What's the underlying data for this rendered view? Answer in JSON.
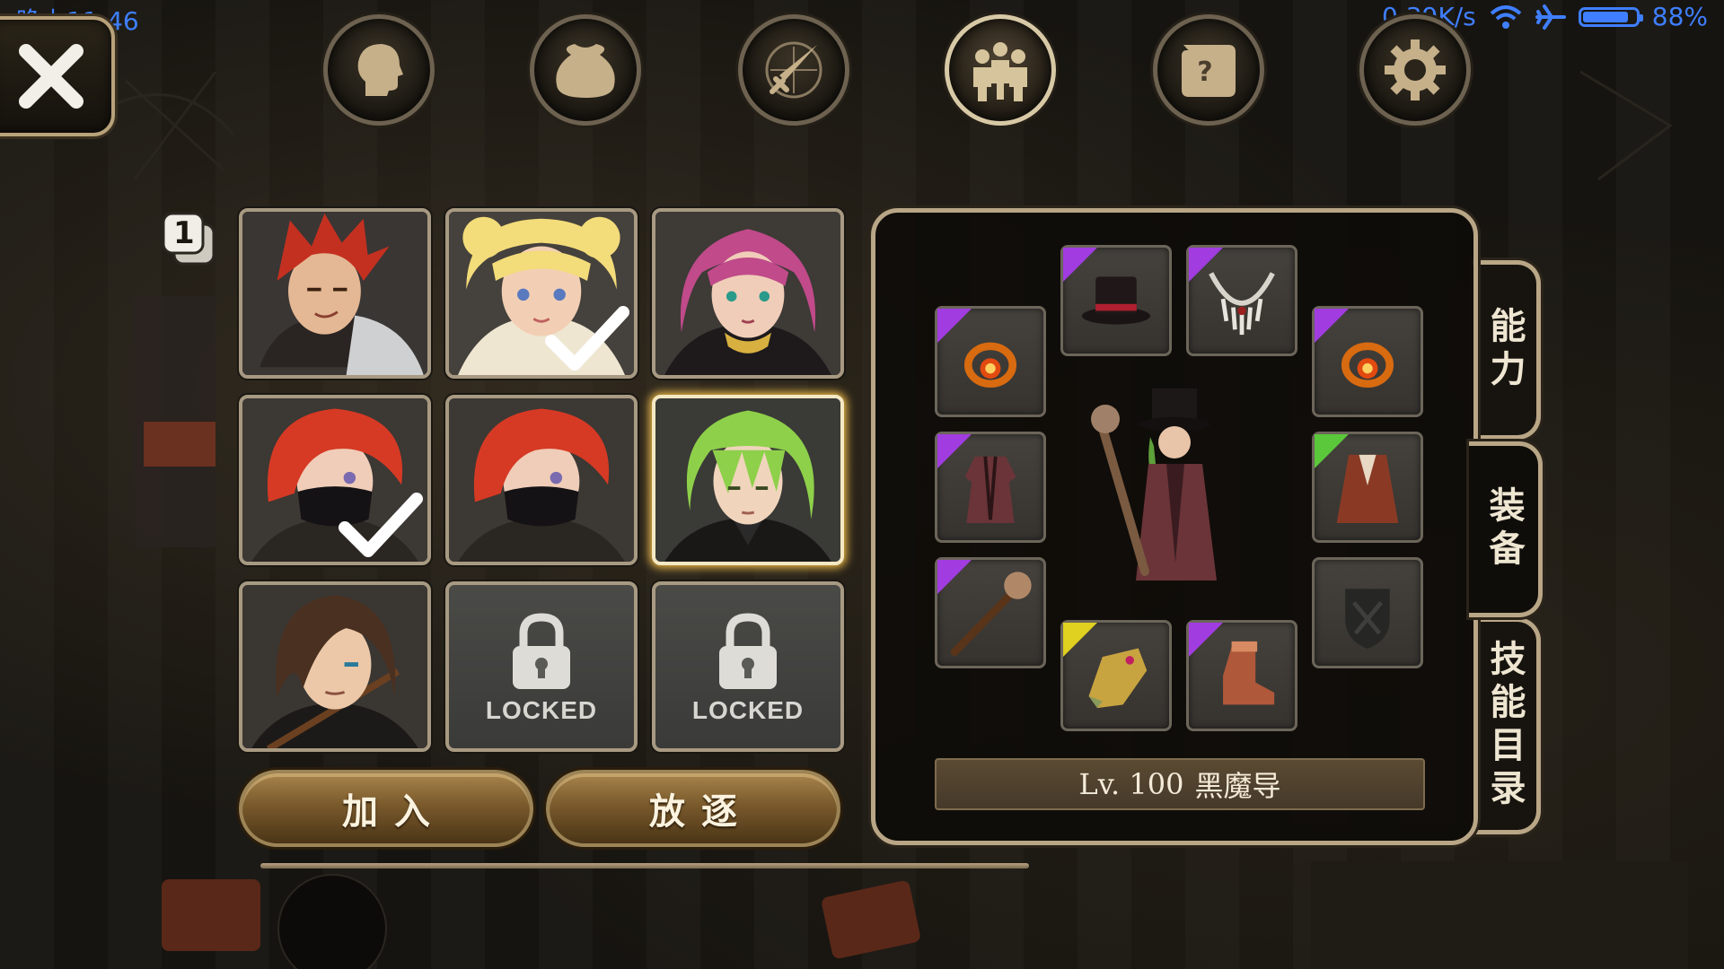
{
  "status_bar": {
    "time": "晚上11:46",
    "network_speed": "0.39K/s",
    "battery_percent": "88%",
    "battery_level": 0.88,
    "icons": [
      "wifi-icon",
      "airplane-icon",
      "battery-icon"
    ],
    "color": "#3f7fff"
  },
  "close_button": {
    "icon": "close-icon"
  },
  "top_nav": {
    "items": [
      {
        "icon": "head-profile-icon",
        "active": false
      },
      {
        "icon": "bag-icon",
        "active": false
      },
      {
        "icon": "crossed-swords-icon",
        "active": false
      },
      {
        "icon": "party-members-icon",
        "active": true
      },
      {
        "icon": "quest-scroll-icon",
        "active": false
      },
      {
        "icon": "settings-gear-icon",
        "active": false
      }
    ]
  },
  "party": {
    "page_badge": "1",
    "slots": [
      {
        "character": "red-spiky-hair-warrior",
        "checked": false,
        "selected": false,
        "locked": false
      },
      {
        "character": "blonde-girl",
        "checked": true,
        "selected": false,
        "locked": false
      },
      {
        "character": "pink-hair-mage",
        "checked": false,
        "selected": false,
        "locked": false
      },
      {
        "character": "red-hair-masked-ninja",
        "checked": true,
        "selected": false,
        "locked": false
      },
      {
        "character": "red-hair-masked-ninja",
        "checked": false,
        "selected": false,
        "locked": false
      },
      {
        "character": "green-hair-man",
        "checked": false,
        "selected": true,
        "locked": false
      },
      {
        "character": "brown-hair-swordsman",
        "checked": false,
        "selected": false,
        "locked": false
      },
      {
        "character": "",
        "checked": false,
        "selected": false,
        "locked": true,
        "label": "LOCKED"
      },
      {
        "character": "",
        "checked": false,
        "selected": false,
        "locked": true,
        "label": "LOCKED"
      }
    ],
    "join_label": "加入",
    "expel_label": "放逐"
  },
  "equipment": {
    "slots": [
      {
        "icon": "top-hat-icon",
        "rarity": "purple"
      },
      {
        "icon": "necklace-icon",
        "rarity": "purple"
      },
      {
        "icon": "ring-icon",
        "rarity": "purple"
      },
      {
        "icon": "ring-icon",
        "rarity": "purple"
      },
      {
        "icon": "robe-icon",
        "rarity": "purple"
      },
      {
        "icon": "cloak-icon",
        "rarity": "green"
      },
      {
        "icon": "staff-icon",
        "rarity": "purple"
      },
      {
        "icon": "shield-slot-empty-icon",
        "rarity": ""
      },
      {
        "icon": "gloves-icon",
        "rarity": "yellow"
      },
      {
        "icon": "boots-icon",
        "rarity": "purple"
      }
    ],
    "level_text": "Lv. 100",
    "class_name": "黑魔导"
  },
  "side_tabs": [
    {
      "label": "能力",
      "active": false
    },
    {
      "label": "装备",
      "active": true
    },
    {
      "label": "技能目录",
      "active": false
    }
  ]
}
